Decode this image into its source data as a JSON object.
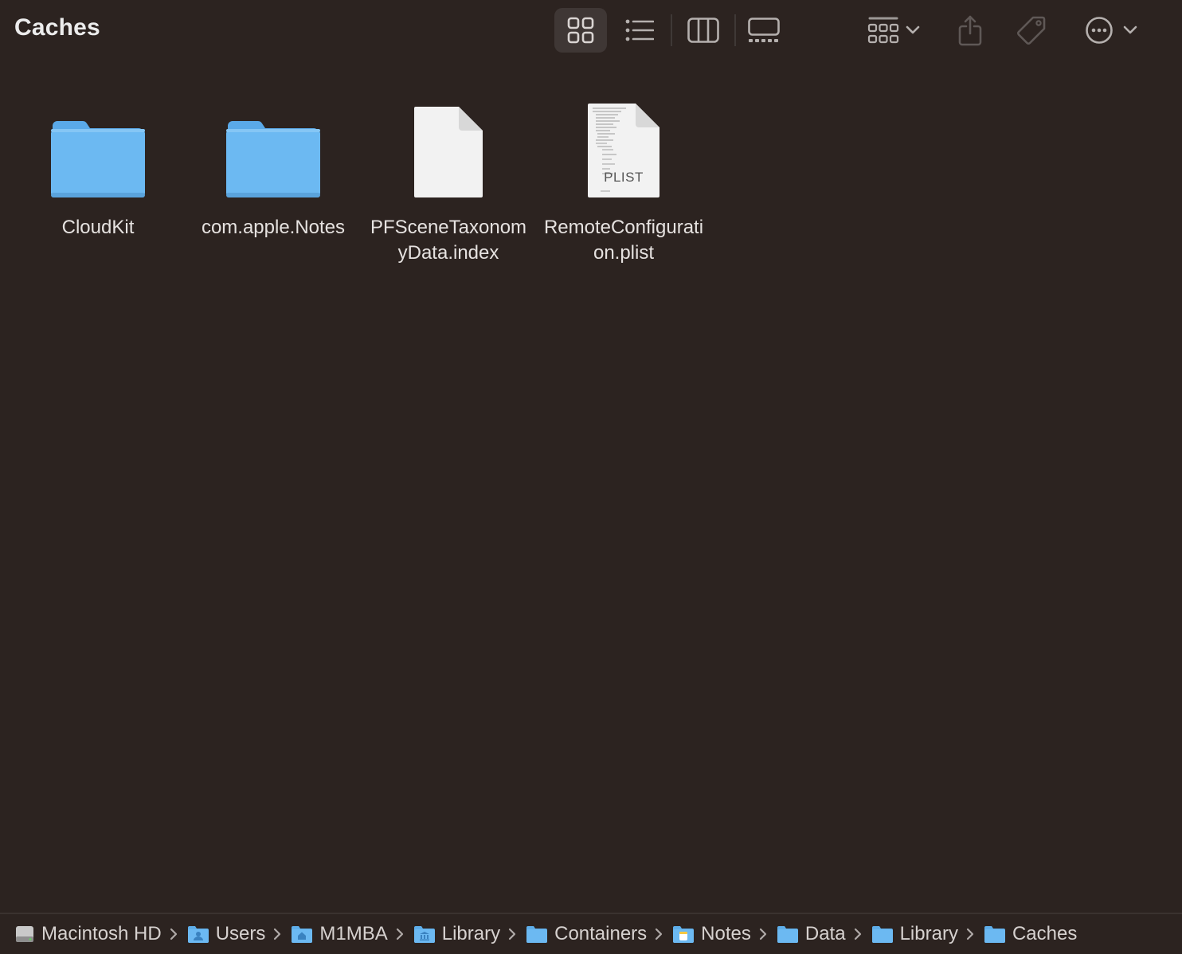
{
  "window": {
    "title": "Caches"
  },
  "toolbar": {
    "view_icons": "grid-view-icon",
    "view_list": "list-view-icon",
    "view_columns": "column-view-icon",
    "view_gallery": "gallery-view-icon",
    "group": "group-icon",
    "share": "share-icon",
    "tag": "tag-icon",
    "more": "more-actions-icon",
    "active_view": "icons"
  },
  "items": [
    {
      "name": "CloudKit",
      "kind": "folder"
    },
    {
      "name": "com.apple.Notes",
      "kind": "folder"
    },
    {
      "name": "PFSceneTaxonomyData.index",
      "kind": "document"
    },
    {
      "name": "RemoteConfiguration.plist",
      "kind": "plist",
      "badge": "PLIST"
    }
  ],
  "pathbar": [
    {
      "label": "Macintosh HD",
      "icon": "hard-drive-icon"
    },
    {
      "label": "Users",
      "icon": "users-folder-icon"
    },
    {
      "label": "M1MBA",
      "icon": "home-folder-icon"
    },
    {
      "label": "Library",
      "icon": "library-folder-icon"
    },
    {
      "label": "Containers",
      "icon": "folder-icon"
    },
    {
      "label": "Notes",
      "icon": "notes-folder-icon"
    },
    {
      "label": "Data",
      "icon": "folder-icon"
    },
    {
      "label": "Library",
      "icon": "folder-icon"
    },
    {
      "label": "Caches",
      "icon": "folder-icon"
    }
  ],
  "colors": {
    "background": "#2c2320",
    "folder": "#6cb7f1",
    "text": "#e6e2e0"
  }
}
